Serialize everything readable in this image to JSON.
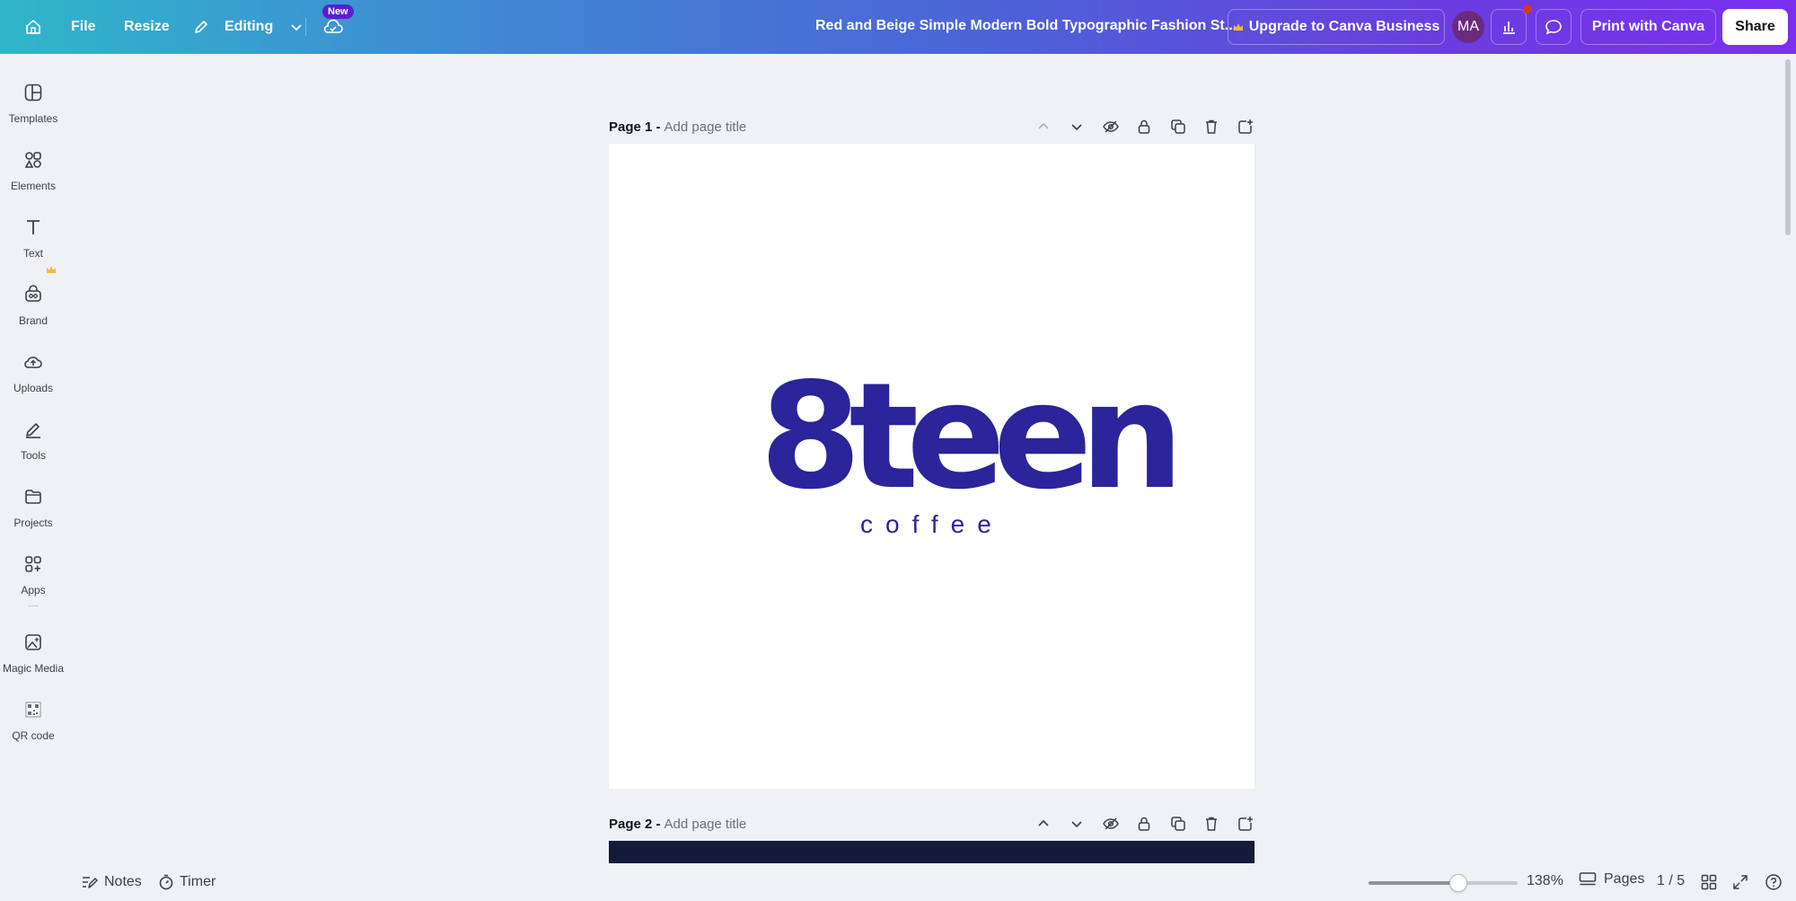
{
  "topbar": {
    "file_label": "File",
    "resize_label": "Resize",
    "editing_label": "Editing",
    "new_badge": "New",
    "document_title": "Red and Beige Simple Modern Bold Typographic Fashion St...",
    "upgrade_label": "Upgrade to Canva Business",
    "avatar_initials": "MA",
    "print_label": "Print with Canva",
    "share_label": "Share"
  },
  "sidebar": {
    "items": [
      {
        "label": "Templates",
        "icon": "templates-icon"
      },
      {
        "label": "Elements",
        "icon": "elements-icon"
      },
      {
        "label": "Text",
        "icon": "text-icon"
      },
      {
        "label": "Brand",
        "icon": "brand-icon"
      },
      {
        "label": "Uploads",
        "icon": "uploads-icon"
      },
      {
        "label": "Tools",
        "icon": "tools-icon"
      },
      {
        "label": "Projects",
        "icon": "projects-icon"
      },
      {
        "label": "Apps",
        "icon": "apps-icon"
      },
      {
        "label": "Magic Media",
        "icon": "magic-media-icon"
      },
      {
        "label": "QR code",
        "icon": "qr-code-icon"
      }
    ]
  },
  "pages": [
    {
      "label": "Page 1 -",
      "title_placeholder": "Add page title"
    },
    {
      "label": "Page 2 -",
      "title_placeholder": "Add page title"
    }
  ],
  "design": {
    "logo_text": "8teen",
    "tagline": "coffee",
    "logo_color": "#2b249a"
  },
  "bottombar": {
    "notes_label": "Notes",
    "timer_label": "Timer",
    "zoom": "138%",
    "zoom_fraction": 0.6,
    "pages_label": "Pages",
    "page_count": "1 / 5"
  },
  "colors": {
    "accent_purple": "#7b2ff0",
    "brand_teal": "#2fb7c9",
    "page2_fill": "#141a3a"
  }
}
